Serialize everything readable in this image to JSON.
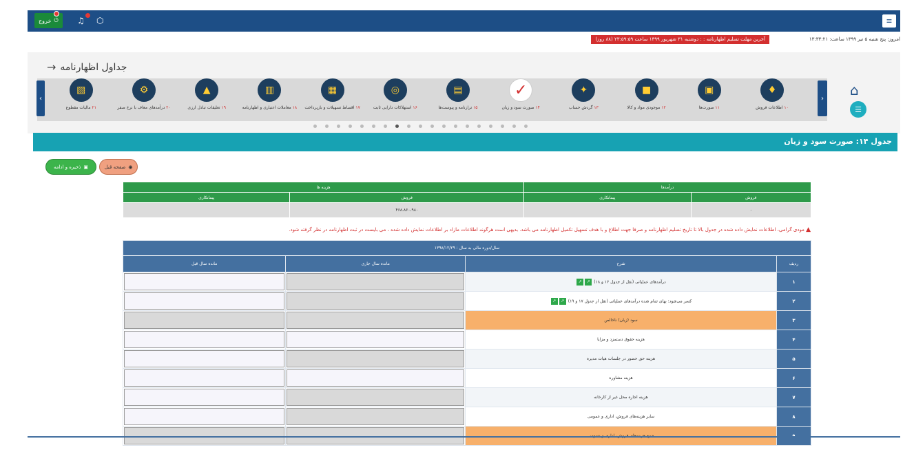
{
  "topbar": {
    "exit_label": "خروج",
    "menu_icon": "hamburger-icon",
    "bell_icon": "bell-icon",
    "cube_icon": "cube-icon"
  },
  "info": {
    "date_text": "امروز: پنج شنبه ۵ تیر ۱۳۹۹ ساعت: ۱۳:۳۳:۲۱",
    "deadline_text": "آخرین مهلت تسلیم اظهارنامه : : دوشنبه ۳۱ شهریور ۱۳۹۹ ساعت ۲۳:۵۹:۵۹ (۸۸ روز)"
  },
  "panel": {
    "title": "جداول اظهارنامه",
    "categories": [
      {
        "num": "۱۰",
        "text": "اطلاعات فروش",
        "icon": "♦"
      },
      {
        "num": "۱۱",
        "text": "صورت‌ها",
        "icon": "▣"
      },
      {
        "num": "۱۲",
        "text": "موجودی مواد و کالا",
        "icon": "■"
      },
      {
        "num": "۱۳",
        "text": "گردش حساب",
        "icon": "✦"
      },
      {
        "num": "۱۴",
        "text": "صورت سود و زیان",
        "icon": "✓"
      },
      {
        "num": "۱۵",
        "text": "ترازنامه و پیوست‌ها",
        "icon": "▤"
      },
      {
        "num": "۱۶",
        "text": "استهلاکات دارایی ثابت",
        "icon": "◎"
      },
      {
        "num": "۱۷",
        "text": "اقساط تسهیلات و بازپرداخت",
        "icon": "▦"
      },
      {
        "num": "۱۸",
        "text": "معاملات اعتباری و اظهارنامه",
        "icon": "▥"
      },
      {
        "num": "۱۹",
        "text": "تعلیقات تبادل ارزی",
        "icon": "▲"
      },
      {
        "num": "۲۰",
        "text": "درآمدهای معاف با نرخ صفر",
        "icon": "⚙"
      },
      {
        "num": "۲۱",
        "text": "مالیات مقطوع",
        "icon": "▧"
      }
    ],
    "active_index": 4
  },
  "section": {
    "title": "جدول ۱۴: صورت سود و زیان"
  },
  "buttons": {
    "save_label": "ذخیره و ادامه",
    "prev_label": "صفحه قبل"
  },
  "summary": {
    "group_income": "درآمدها",
    "group_costs": "هزینه ها",
    "col_sale": "فروش",
    "col_contract": "پیمانکاری",
    "val_income_sale": "۰",
    "val_income_contract": "",
    "val_cost_sale": "۴۶۸،۸۶۰،۹۸۰",
    "val_cost_contract": ""
  },
  "warning": "مودی گرامی، اطلاعات نمایش داده شده در جدول بالا تا تاریخ تسلیم اظهارنامه و صرفا جهت اطلاع و با هدف تسهیل تکمیل اظهارنامه می باشد. بدیهی است هرگونه اطلاعات مازاد بر اطلاعات نمایش داده شده ، می بایست در ثبت اظهارنامه در نظر گرفته شود.",
  "table": {
    "period": "سال/دوره مالی به سال : ۱۳۹۸/۱۲/۲۹",
    "headers": {
      "row": "ردیف",
      "desc": "شرح",
      "current": "مانده سال جاری",
      "previous": "مانده سال قبل"
    },
    "rows": [
      {
        "n": "۱",
        "desc": "درآمدهای عملیاتی (نقل از جدول ۱۶ و ۱۸)",
        "mini": true
      },
      {
        "n": "۲",
        "desc": "کسر می‌شود: بهای تمام شده درآمدهای عملیاتی (نقل از جدول ۱۷ و ۱۹)",
        "mini": true
      },
      {
        "n": "۳",
        "desc": "سود (زیان) ناخالص",
        "mini": false
      },
      {
        "n": "۴",
        "desc": "هزینه حقوق دستمزد و مزایا",
        "mini": false
      },
      {
        "n": "۵",
        "desc": "هزینه حق حضور در جلسات هیات مدیره",
        "mini": false
      },
      {
        "n": "۶",
        "desc": "هزینه مشاوره",
        "mini": false
      },
      {
        "n": "۷",
        "desc": "هزینه اجاره محل غیر از کارخانه",
        "mini": false
      },
      {
        "n": "۸",
        "desc": "سایر هزینه‌های فروش، اداری و عمومی",
        "mini": false
      },
      {
        "n": "۹",
        "desc": "جمع هزینه‌های فروش، اداری و عمومی",
        "mini": false
      }
    ]
  }
}
